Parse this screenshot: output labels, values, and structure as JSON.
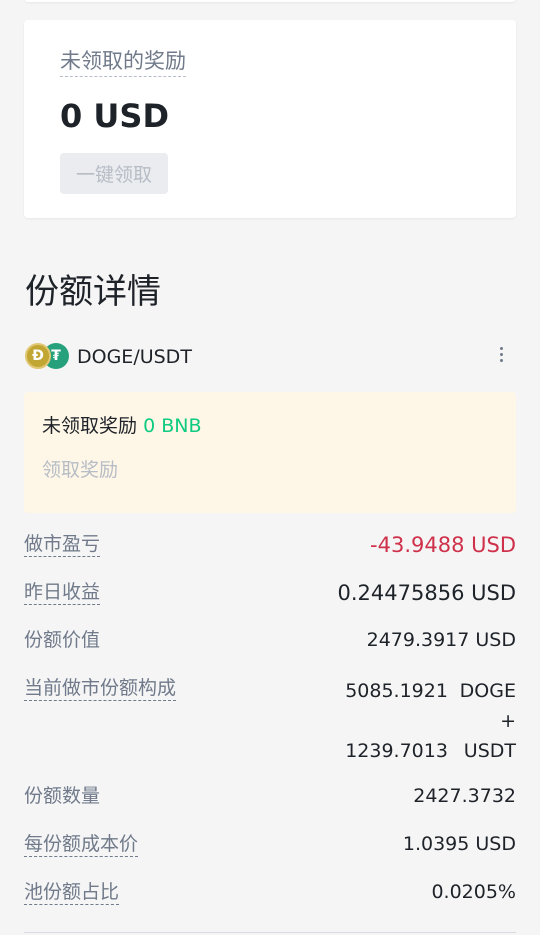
{
  "rewards": {
    "title": "未领取的奖励",
    "amount": "0 USD",
    "claim_all_label": "一键领取"
  },
  "share_details": {
    "title": "份额详情",
    "pair": {
      "name": "DOGE/USDT",
      "base_icon": "doge-coin-icon",
      "base_glyph": "Ð",
      "quote_icon": "usdt-coin-icon",
      "quote_glyph": "₮"
    },
    "pending": {
      "label": "未领取奖励",
      "value": "0 BNB",
      "claim_label": "领取奖励"
    },
    "rows": {
      "pnl": {
        "label": "做市盈亏",
        "value": "-43.9488 USD"
      },
      "yesterday": {
        "label": "昨日收益",
        "value": "0.24475856 USD"
      },
      "share_value": {
        "label": "份额价值",
        "value": "2479.3917 USD"
      },
      "composition": {
        "label": "当前做市份额构成",
        "base_amount": "5085.1921",
        "base_token": "DOGE",
        "plus": "+",
        "quote_amount": "1239.7013",
        "quote_token": "USDT"
      },
      "share_count": {
        "label": "份额数量",
        "value": "2427.3732"
      },
      "cost_per_share": {
        "label": "每份额成本价",
        "value": "1.0395 USD"
      },
      "pool_ratio": {
        "label": "池份额占比",
        "value": "0.0205%"
      }
    }
  },
  "colors": {
    "negative": "#cf304a",
    "positive": "#0ecb81",
    "pending_bg": "#fef6e6",
    "muted": "#707a8a"
  }
}
